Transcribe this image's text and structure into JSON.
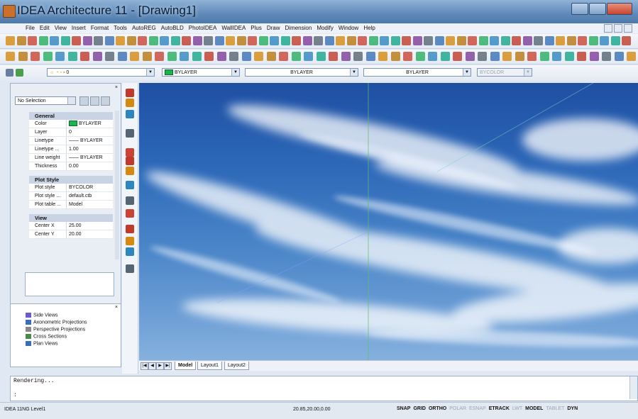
{
  "window": {
    "title": "IDEA Architecture 11  - [Drawing1]"
  },
  "menu": [
    "File",
    "Edit",
    "View",
    "Insert",
    "Format",
    "Tools",
    "AutoREG",
    "AutoBLD",
    "PhotoIDEA",
    "WallIDEA",
    "Plus",
    "Draw",
    "Dimension",
    "Modify",
    "Window",
    "Help"
  ],
  "properties_bar": {
    "layer_value": "0",
    "color_value": "BYLAYER",
    "linetype_value": "BYLAYER",
    "lineweight_value": "BYLAYER",
    "plotstyle_value": "BYCOLOR"
  },
  "properties_panel": {
    "selection": "No Selection",
    "sections": [
      {
        "title": "General",
        "rows": [
          {
            "key": "Color",
            "value": "BYLAYER"
          },
          {
            "key": "Layer",
            "value": "0"
          },
          {
            "key": "Linetype",
            "value": "—— BYLAYER"
          },
          {
            "key": "Linetype ...",
            "value": "1.00"
          },
          {
            "key": "Line weight",
            "value": "—— BYLAYER"
          },
          {
            "key": "Thickness",
            "value": "0.00"
          }
        ]
      },
      {
        "title": "Plot Style",
        "rows": [
          {
            "key": "Plot style",
            "value": "BYCOLOR"
          },
          {
            "key": "Plot style ...",
            "value": "default.ctb"
          },
          {
            "key": "Plot table ...",
            "value": "Model"
          }
        ]
      },
      {
        "title": "View",
        "rows": [
          {
            "key": "Center X",
            "value": "25.00"
          },
          {
            "key": "Center Y",
            "value": "20.00"
          }
        ]
      }
    ]
  },
  "views_panel": [
    "Side Views",
    "Axonometric Projections",
    "Perspective Projections",
    "Cross Sections",
    "Plan Views"
  ],
  "layout_tabs": [
    "Model",
    "Layout1",
    "Layout2"
  ],
  "command": {
    "line1": "Rendering...",
    "line2": ":"
  },
  "status": {
    "left": "IDEA 11NG Level1",
    "coords": "20.85,20.00,0.00",
    "modes": [
      {
        "label": "SNAP",
        "on": true
      },
      {
        "label": "GRID",
        "on": true
      },
      {
        "label": "ORTHO",
        "on": true
      },
      {
        "label": "POLAR",
        "on": false
      },
      {
        "label": "ESNAP",
        "on": false
      },
      {
        "label": "ETRACK",
        "on": true
      },
      {
        "label": "LWT",
        "on": false
      },
      {
        "label": "MODEL",
        "on": true
      },
      {
        "label": "TABLET",
        "on": false
      },
      {
        "label": "DYN",
        "on": true
      }
    ]
  }
}
